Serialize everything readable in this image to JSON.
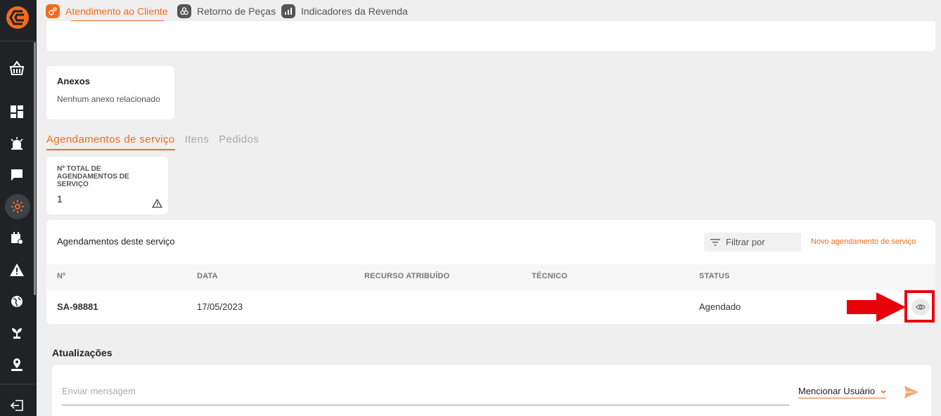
{
  "sidebar": {
    "items": [
      {
        "name": "basket-icon"
      },
      {
        "name": "dashboard-icon"
      },
      {
        "name": "alarm-icon"
      },
      {
        "name": "chat-icon"
      },
      {
        "name": "gear-icon"
      },
      {
        "name": "calendar-icon"
      },
      {
        "name": "warning-icon"
      },
      {
        "name": "globe-icon"
      },
      {
        "name": "plant-icon"
      },
      {
        "name": "location-person-icon"
      },
      {
        "name": "logout-icon"
      }
    ]
  },
  "topbar": {
    "tabs": [
      {
        "label": "Atendimento ao Cliente",
        "active": true
      },
      {
        "label": "Retorno de Peças"
      },
      {
        "label": "Indicadores da Revenda"
      }
    ]
  },
  "attachments": {
    "title": "Anexos",
    "empty_text": "Nenhum anexo relacionado"
  },
  "subtabs": [
    "Agendamentos de serviço",
    "Itens",
    "Pedidos"
  ],
  "kpi": {
    "label": "Nº TOTAL DE AGENDAMENTOS DE SERVIÇO",
    "value": "1"
  },
  "schedules": {
    "title": "Agendamentos deste serviço",
    "filter_placeholder": "Filtrar por",
    "new_link": "Novo agendamento de serviço",
    "columns": [
      "Nº",
      "DATA",
      "RECURSO ATRIBUÍDO",
      "TÉCNICO",
      "STATUS"
    ],
    "rows": [
      {
        "number": "SA-98881",
        "date": "17/05/2023",
        "resource": "",
        "technician": "",
        "status": "Agendado"
      }
    ]
  },
  "updates": {
    "title": "Atualizações",
    "message_placeholder": "Enviar mensagem",
    "mention_label": "Mencionar Usuário"
  },
  "colors": {
    "accent": "#f26b21",
    "sidebar": "#1f2326",
    "highlight": "#e8000b"
  }
}
